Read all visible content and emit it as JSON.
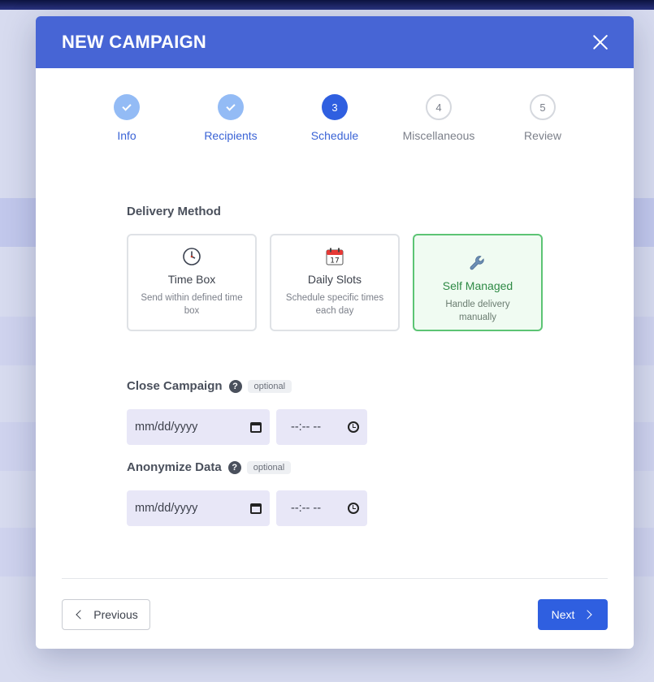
{
  "modal": {
    "title": "NEW CAMPAIGN"
  },
  "stepper": {
    "steps": [
      {
        "number": "",
        "label": "Info",
        "state": "done"
      },
      {
        "number": "",
        "label": "Recipients",
        "state": "done"
      },
      {
        "number": "3",
        "label": "Schedule",
        "state": "active"
      },
      {
        "number": "4",
        "label": "Miscellaneous",
        "state": "pending"
      },
      {
        "number": "5",
        "label": "Review",
        "state": "pending"
      }
    ]
  },
  "delivery": {
    "label": "Delivery Method",
    "options": [
      {
        "icon": "clock-icon",
        "title": "Time Box",
        "desc": "Send within defined time box",
        "selected": false
      },
      {
        "icon": "calendar-icon",
        "title": "Daily Slots",
        "desc": "Schedule specific times each day",
        "selected": false
      },
      {
        "icon": "wrench-icon",
        "title": "Self Managed",
        "desc": "Handle delivery manually",
        "selected": true
      }
    ]
  },
  "close_campaign": {
    "label": "Close Campaign",
    "help": "?",
    "badge": "optional",
    "date_placeholder": "mm/dd/yyyy",
    "time_placeholder": "--:-- --"
  },
  "anonymize": {
    "label": "Anonymize Data",
    "help": "?",
    "badge": "optional",
    "date_placeholder": "mm/dd/yyyy",
    "time_placeholder": "--:-- --"
  },
  "footer": {
    "previous_label": "Previous",
    "next_label": "Next"
  },
  "colors": {
    "header": "#4765d5",
    "primary": "#2f5fe0",
    "selected_border": "#5cc474"
  }
}
